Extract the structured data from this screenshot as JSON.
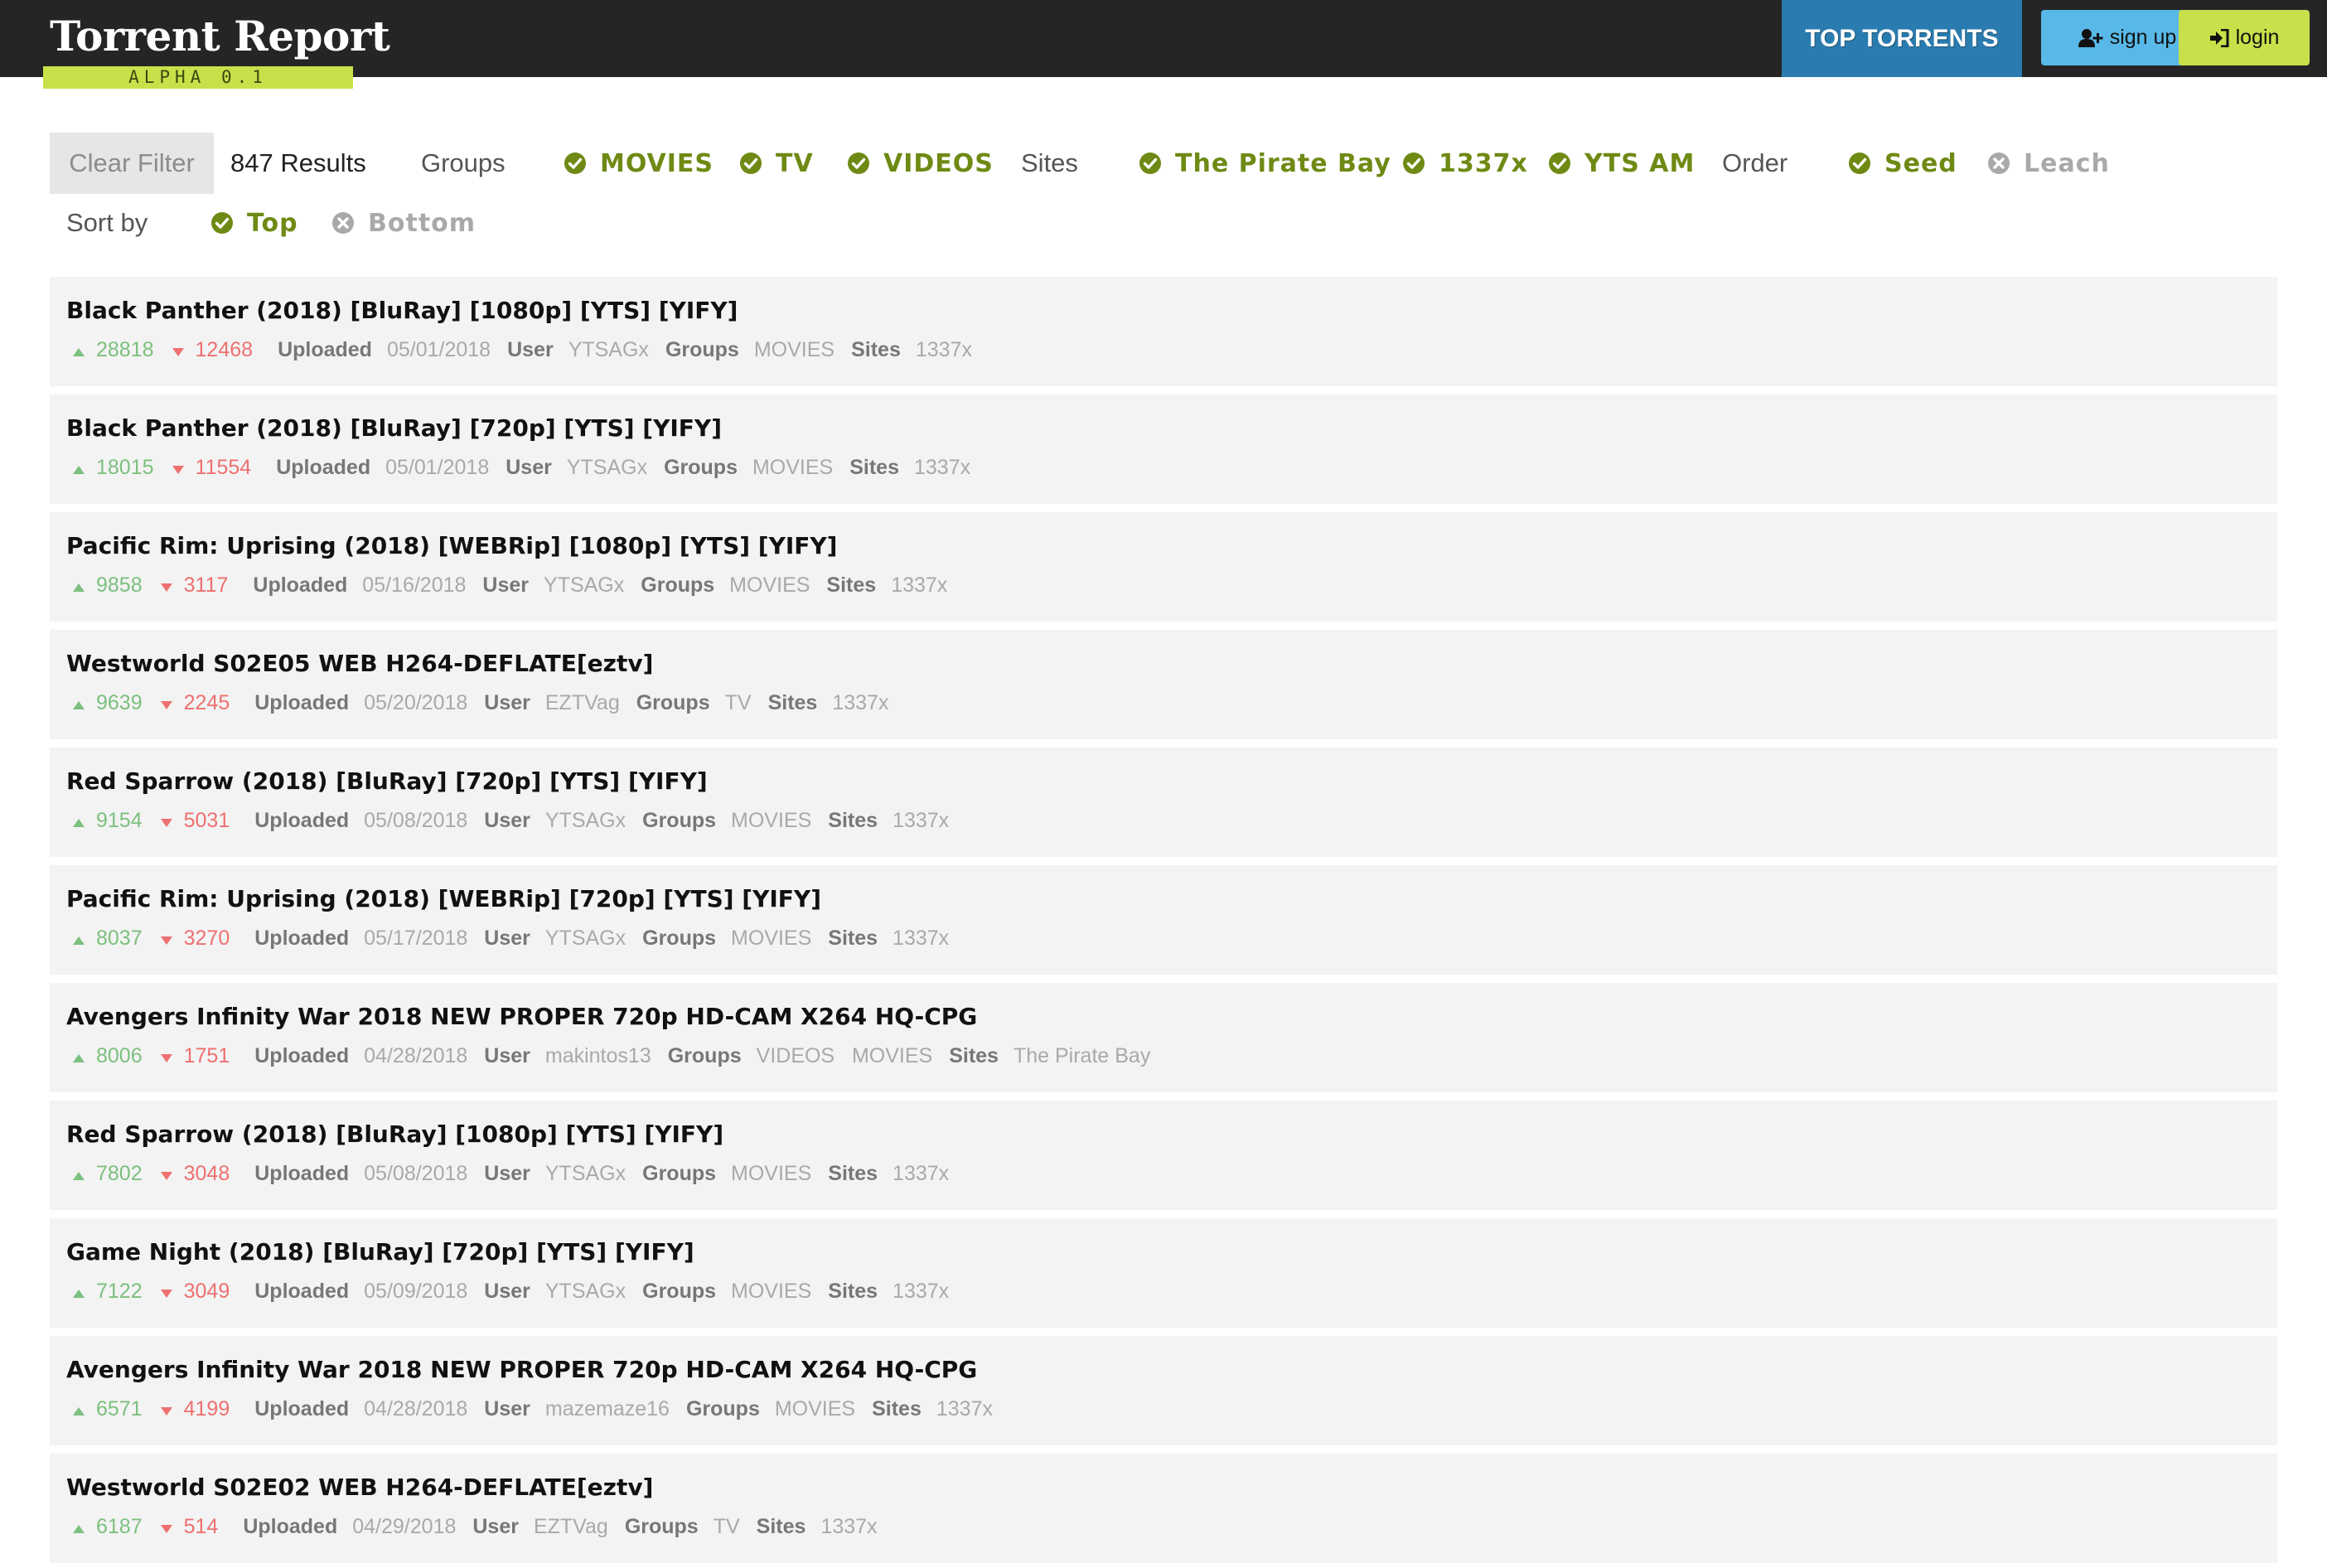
{
  "header": {
    "logo_title": "Torrent Report",
    "logo_subtitle": "ALPHA 0.1",
    "top_torrents_label": "TOP TORRENTS",
    "signup_label": "sign up",
    "login_label": "login"
  },
  "filters": {
    "clear_filter": "Clear Filter",
    "results_count": "847 Results",
    "groups_label": "Groups",
    "groups": [
      {
        "label": "MOVIES",
        "checked": true
      },
      {
        "label": "TV",
        "checked": true
      },
      {
        "label": "VIDEOS",
        "checked": true
      }
    ],
    "sites_label": "Sites",
    "sites": [
      {
        "label": "The Pirate Bay",
        "checked": true
      },
      {
        "label": "1337x",
        "checked": true
      },
      {
        "label": "YTS AM",
        "checked": true
      }
    ],
    "order_label": "Order",
    "order": [
      {
        "label": "Seed",
        "checked": true
      },
      {
        "label": "Leach",
        "checked": false
      }
    ],
    "sort_label": "Sort by",
    "sort": [
      {
        "label": "Top",
        "checked": true
      },
      {
        "label": "Bottom",
        "checked": false
      }
    ]
  },
  "meta_labels": {
    "uploaded": "Uploaded",
    "user": "User",
    "groups": "Groups",
    "sites": "Sites"
  },
  "colors": {
    "checked": "#6e8a14",
    "unchecked": "#a9a9a9",
    "seed": "#7cc07e",
    "leech": "#ee7070",
    "top_torrents_bg": "#2a7cb0",
    "signup_bg": "#58b8e8",
    "login_bg": "#c9e04a"
  },
  "torrents": [
    {
      "title": "Black Panther (2018) [BluRay] [1080p] [YTS] [YIFY]",
      "seeds": "28818",
      "leeches": "12468",
      "uploaded": "05/01/2018",
      "user": "YTSAGx",
      "groups": "MOVIES",
      "sites": "1337x"
    },
    {
      "title": "Black Panther (2018) [BluRay] [720p] [YTS] [YIFY]",
      "seeds": "18015",
      "leeches": "11554",
      "uploaded": "05/01/2018",
      "user": "YTSAGx",
      "groups": "MOVIES",
      "sites": "1337x"
    },
    {
      "title": "Pacific Rim: Uprising (2018) [WEBRip] [1080p] [YTS] [YIFY]",
      "seeds": "9858",
      "leeches": "3117",
      "uploaded": "05/16/2018",
      "user": "YTSAGx",
      "groups": "MOVIES",
      "sites": "1337x"
    },
    {
      "title": "Westworld S02E05 WEB H264-DEFLATE[eztv]",
      "seeds": "9639",
      "leeches": "2245",
      "uploaded": "05/20/2018",
      "user": "EZTVag",
      "groups": "TV",
      "sites": "1337x"
    },
    {
      "title": "Red Sparrow (2018) [BluRay] [720p] [YTS] [YIFY]",
      "seeds": "9154",
      "leeches": "5031",
      "uploaded": "05/08/2018",
      "user": "YTSAGx",
      "groups": "MOVIES",
      "sites": "1337x"
    },
    {
      "title": "Pacific Rim: Uprising (2018) [WEBRip] [720p] [YTS] [YIFY]",
      "seeds": "8037",
      "leeches": "3270",
      "uploaded": "05/17/2018",
      "user": "YTSAGx",
      "groups": "MOVIES",
      "sites": "1337x"
    },
    {
      "title": "Avengers Infinity War 2018 NEW PROPER 720p HD-CAM X264 HQ-CPG",
      "seeds": "8006",
      "leeches": "1751",
      "uploaded": "04/28/2018",
      "user": "makintos13",
      "groups": "VIDEOS   MOVIES",
      "sites": "The Pirate Bay"
    },
    {
      "title": "Red Sparrow (2018) [BluRay] [1080p] [YTS] [YIFY]",
      "seeds": "7802",
      "leeches": "3048",
      "uploaded": "05/08/2018",
      "user": "YTSAGx",
      "groups": "MOVIES",
      "sites": "1337x"
    },
    {
      "title": "Game Night (2018) [BluRay] [720p] [YTS] [YIFY]",
      "seeds": "7122",
      "leeches": "3049",
      "uploaded": "05/09/2018",
      "user": "YTSAGx",
      "groups": "MOVIES",
      "sites": "1337x"
    },
    {
      "title": "Avengers Infinity War 2018 NEW PROPER 720p HD-CAM X264 HQ-CPG",
      "seeds": "6571",
      "leeches": "4199",
      "uploaded": "04/28/2018",
      "user": "mazemaze16",
      "groups": "MOVIES",
      "sites": "1337x"
    },
    {
      "title": "Westworld S02E02 WEB H264-DEFLATE[eztv]",
      "seeds": "6187",
      "leeches": "514",
      "uploaded": "04/29/2018",
      "user": "EZTVag",
      "groups": "TV",
      "sites": "1337x"
    }
  ]
}
